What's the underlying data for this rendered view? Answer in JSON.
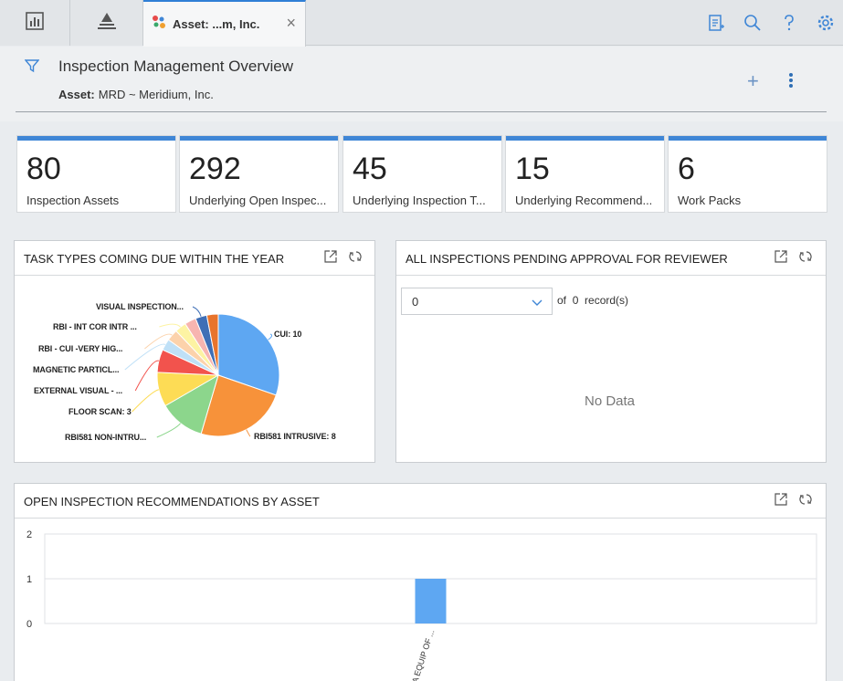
{
  "topbar": {
    "tab_label": "Asset: ...m, Inc.",
    "icons": [
      "dashboard-icon",
      "hierarchy-icon",
      "asset-tab-icon",
      "clipboard-icon",
      "search-icon",
      "help-icon",
      "gear-icon"
    ]
  },
  "header": {
    "title": "Inspection Management Overview",
    "asset_label": "Asset:",
    "asset_value": "MRD ~ Meridium, Inc."
  },
  "cards": [
    {
      "value": "80",
      "label": "Inspection Assets"
    },
    {
      "value": "292",
      "label": "Underlying Open Inspec..."
    },
    {
      "value": "45",
      "label": "Underlying Inspection T..."
    },
    {
      "value": "15",
      "label": "Underlying Recommend..."
    },
    {
      "value": "6",
      "label": "Work Packs"
    }
  ],
  "panel_tasks": {
    "title": "TASK TYPES COMING DUE WITHIN THE YEAR"
  },
  "panel_pending": {
    "title": "ALL INSPECTIONS PENDING APPROVAL FOR REVIEWER",
    "select_value": "0",
    "of_label": "of",
    "record_count": "0",
    "records_label": "record(s)",
    "no_data": "No Data"
  },
  "panel_recs": {
    "title": "OPEN INSPECTION RECOMMENDATIONS BY ASSET"
  },
  "colors": {
    "accent": "#3f86d6",
    "bar": "#5ea7f2"
  },
  "chart_data": [
    {
      "type": "pie",
      "title": "TASK TYPES COMING DUE WITHIN THE YEAR",
      "slices": [
        {
          "label": "CUI: 10",
          "value": 10,
          "color": "#5ea7f2"
        },
        {
          "label": "RBI581 INTRUSIVE: 8",
          "value": 8,
          "color": "#f7923a"
        },
        {
          "label": "RBI581 NON-INTRU...",
          "value": 4,
          "color": "#8cd68c"
        },
        {
          "label": "FLOOR SCAN: 3",
          "value": 3,
          "color": "#fddc55"
        },
        {
          "label": "EXTERNAL VISUAL - ...",
          "value": 2,
          "color": "#f2534d"
        },
        {
          "label": "MAGNETIC PARTICL...",
          "value": 1,
          "color": "#bfe0f7"
        },
        {
          "label": "RBI - CUI -VERY HIG...",
          "value": 1,
          "color": "#fcd2ab"
        },
        {
          "label": "RBI - INT COR INTR ...",
          "value": 1,
          "color": "#fdf3a3"
        },
        {
          "label": "",
          "value": 1,
          "color": "#f7b5b0"
        },
        {
          "label": "VISUAL INSPECTION...",
          "value": 1,
          "color": "#3f6fb6"
        },
        {
          "label": "",
          "value": 1,
          "color": "#e8742c"
        }
      ]
    },
    {
      "type": "bar",
      "title": "OPEN INSPECTION RECOMMENDATIONS BY ASSET",
      "categories": [
        "A EQUIP OF ..."
      ],
      "values": [
        1
      ],
      "ylim": [
        0,
        2
      ],
      "yticks": [
        "0",
        "1",
        "2"
      ]
    }
  ]
}
